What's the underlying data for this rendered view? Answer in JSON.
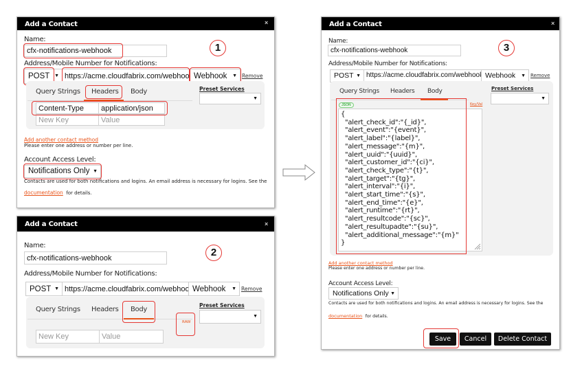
{
  "common": {
    "dialog_title": "Add a Contact",
    "close_label": "×",
    "name_label": "Name:",
    "name_value": "cfx-notifications-webhook",
    "address_label": "Address/Mobile Number for Notifications:",
    "method_value": "POST",
    "url_value": "https://acme.cloudfabrix.com/webhooks",
    "type_value": "Webhook",
    "remove_label": "Remove",
    "tabs": [
      "Query Strings",
      "Headers",
      "Body"
    ],
    "preset_label": "Preset Services",
    "new_key_placeholder": "New Key",
    "value_placeholder": "Value",
    "add_method_link": "Add another contact method",
    "add_method_hint": "Please enter one address or number per line.",
    "access_label": "Account Access Level:",
    "access_value": "Notifications Only",
    "contacts_note": "Contacts are used for both notifications and logins. An email address is necessary for logins. See the",
    "documentation_link": "documentation",
    "details_text": "for details.",
    "accent_color": "#e8541a",
    "highlight_color": "#e53935"
  },
  "step1": {
    "number": "1",
    "active_tab": "Headers",
    "header_key": "Content-Type",
    "header_value": "application/json"
  },
  "step2": {
    "number": "2",
    "active_tab": "Body",
    "raw_toggle": "RAW"
  },
  "step3": {
    "number": "3",
    "active_tab": "Body",
    "json_badge": "JSON",
    "keyval_toggle": "Key/Val",
    "body_json": "{\n  \"alert_check_id\":\"{_id}\",\n  \"alert_event\":\"{event}\",\n  \"alert_label\":\"{label}\",\n  \"alert_message\":\"{m}\",\n  \"alert_uuid\":\"{uuid}\",\n  \"alert_customer_id\":\"{ci}\",\n  \"alert_check_type\":\"{t}\",\n  \"alert_target\":\"{tg}\",\n  \"alert_interval\":\"{i}\",\n  \"alert_start_time\":\"{s}\",\n  \"alert_end_time\":\"{e}\",\n  \"alert_runtime\":\"{rt}\",\n  \"alert_resultcode\":\"{sc}\",\n  \"alert_resultupadte\":\"{su}\",\n  \"alert_additional_message\":\"{m}\"\n}",
    "save_label": "Save",
    "cancel_label": "Cancel",
    "delete_label": "Delete Contact"
  },
  "arrow_icon": "right-arrow-outline"
}
